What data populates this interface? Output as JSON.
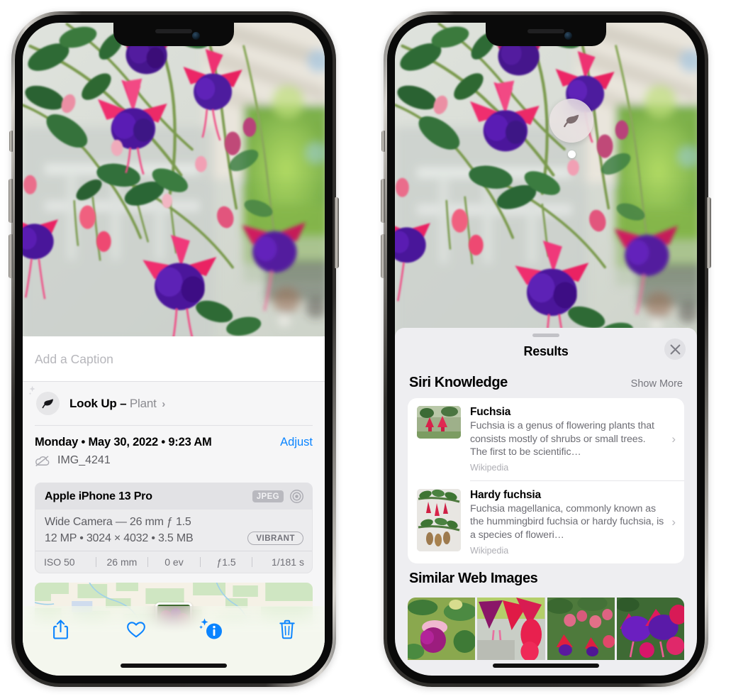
{
  "left_phone": {
    "caption_field": {
      "placeholder": "Add a Caption",
      "value": ""
    },
    "lookup": {
      "label": "Look Up –",
      "subject": "Plant",
      "chevron": "›",
      "icon": "leaf-icon"
    },
    "metadata": {
      "date_line": "Monday • May 30, 2022 • 9:23 AM",
      "adjust_label": "Adjust",
      "filename": "IMG_4241",
      "cloud_icon": "cloud-slash-icon"
    },
    "exif": {
      "model": "Apple iPhone 13 Pro",
      "format_badge": "JPEG",
      "lens_icon": "aperture-icon",
      "lens_line": "Wide Camera — 26 mm ƒ 1.5",
      "size_line": "12 MP • 3024 × 4032 • 3.5 MB",
      "profile_badge": "VIBRANT",
      "stats": [
        "ISO 50",
        "26 mm",
        "0 ev",
        "ƒ1.5",
        "1/181 s"
      ]
    },
    "toolbar": [
      {
        "name": "share-button",
        "icon": "share-icon",
        "active": false
      },
      {
        "name": "favorite-button",
        "icon": "heart-icon",
        "active": false
      },
      {
        "name": "info-button",
        "icon": "info-sparkle-icon",
        "active": true
      },
      {
        "name": "delete-button",
        "icon": "trash-icon",
        "active": false
      }
    ],
    "accent_color": "#0a84ff"
  },
  "right_phone": {
    "visual_lookup_badge": {
      "icon": "leaf-icon",
      "tooltip": "Plant"
    },
    "sheet": {
      "title": "Results",
      "close_icon": "close-icon",
      "sections": [
        {
          "title": "Siri Knowledge",
          "action": "Show More",
          "items": [
            {
              "title": "Fuchsia",
              "description": "Fuchsia is a genus of flowering plants that consists mostly of shrubs or small trees. The first to be scientific…",
              "source": "Wikipedia",
              "chevron": "›"
            },
            {
              "title": "Hardy fuchsia",
              "description": "Fuchsia magellanica, commonly known as the hummingbird fuchsia or hardy fuchsia, is a species of floweri…",
              "source": "Wikipedia",
              "chevron": "›"
            }
          ]
        },
        {
          "title": "Similar Web Images",
          "images": [
            "web-image-1",
            "web-image-2",
            "web-image-3",
            "web-image-4"
          ]
        }
      ]
    }
  }
}
